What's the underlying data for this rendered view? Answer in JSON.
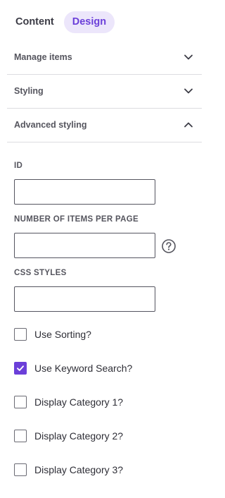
{
  "tabs": [
    {
      "label": "Content",
      "active": false
    },
    {
      "label": "Design",
      "active": true
    }
  ],
  "sections": [
    {
      "label": "Manage items",
      "expanded": false
    },
    {
      "label": "Styling",
      "expanded": false
    },
    {
      "label": "Advanced styling",
      "expanded": true
    }
  ],
  "fields": {
    "id": {
      "label": "ID",
      "value": ""
    },
    "items_per_page": {
      "label": "NUMBER OF ITEMS PER PAGE",
      "value": ""
    },
    "css_styles": {
      "label": "CSS STYLES",
      "value": ""
    }
  },
  "checkboxes": [
    {
      "label": "Use Sorting?",
      "checked": false
    },
    {
      "label": "Use Keyword Search?",
      "checked": true
    },
    {
      "label": "Display Category 1?",
      "checked": false
    },
    {
      "label": "Display Category 2?",
      "checked": false
    },
    {
      "label": "Display Category 3?",
      "checked": false
    }
  ],
  "icons": {
    "section_collapsed": "chevron-down-icon",
    "section_expanded": "chevron-up-icon",
    "help": "help-circle-icon",
    "check": "check-icon"
  },
  "colors": {
    "accent": "#6b3fd9",
    "accent_bg": "#ece6fb",
    "divider": "#dcdce0",
    "input_border": "#555560"
  }
}
